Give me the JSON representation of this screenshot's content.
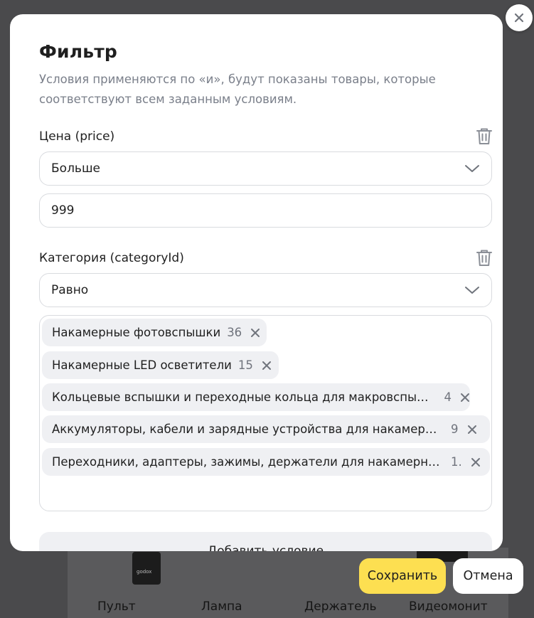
{
  "background": {
    "products": [
      "Пульт",
      "Лампа",
      "Держатель",
      "Видеомонит"
    ],
    "product_brand": "godox"
  },
  "modal": {
    "title": "Фильтр",
    "description": "Условия применяются по «и», будут показаны товары, которые соответствуют всем заданным условиям.",
    "conditions": [
      {
        "label": "Цена (price)",
        "operator": "Больше",
        "value": "999"
      },
      {
        "label": "Категория (categoryId)",
        "operator": "Равно",
        "tags": [
          {
            "label": "Накамерные фотовспышки",
            "count": "36"
          },
          {
            "label": "Накамерные LED осветители",
            "count": "15"
          },
          {
            "label": "Кольцевые вспышки и переходные кольца для макровспышек",
            "count": "4"
          },
          {
            "label": "Аккумуляторы, кабели и зарядные устройства для накамерных...",
            "count": "9"
          },
          {
            "label": "Переходники, адаптеры, зажимы, держатели для накамерных ...",
            "count": "1."
          }
        ]
      }
    ],
    "add_condition_label": "Добавить условие"
  },
  "footer": {
    "save_label": "Сохранить",
    "cancel_label": "Отмена"
  },
  "colors": {
    "accent": "#fddf51",
    "tag_bg": "#eff0f3",
    "border": "#d9dbdf"
  },
  "icons": [
    "close-icon",
    "trash-icon",
    "chevron-down-icon",
    "remove-tag-icon"
  ]
}
